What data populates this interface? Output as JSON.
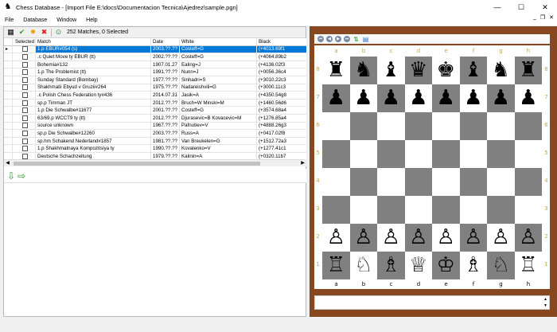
{
  "window": {
    "title": "Chess Database - [Import File E:\\docs\\Documentacion Tecnica\\Ajedrez\\sample.pgn]",
    "app_icon": "chess-knight-icon",
    "minimize": "—",
    "maximize": "☐",
    "close": "✕"
  },
  "menu": {
    "items": [
      "File",
      "Database",
      "Window",
      "Help"
    ],
    "mdi_minimize": "_",
    "mdi_restore": "❐",
    "mdi_close": "✕"
  },
  "toolbar": {
    "icons": [
      "board-icon",
      "check-icon",
      "star-icon",
      "delete-icon",
      "filter-icon"
    ],
    "status": "252 Matches, 0 Selected"
  },
  "grid": {
    "columns": [
      "",
      "Selected",
      "Match",
      "Date",
      "White",
      "Black"
    ],
    "rows": [
      {
        "match": "1.p EBUR#054 (s)",
        "date": "2003.??.??",
        "white": "Costeff=G",
        "black": "(+4013.69f1",
        "selected": true
      },
      {
        "match": ".c Quiet Move ty EBUR (tt)",
        "date": "2002.??.??",
        "white": "Costeff=G",
        "black": "(+4064.89b2",
        "selected": false
      },
      {
        "match": "Bohemia#132",
        "date": "1907.01.27",
        "white": "Ealing=J",
        "black": "(+4136.02f3",
        "selected": false
      },
      {
        "match": "1.p The Problemist (tt)",
        "date": "1991.??.??",
        "white": "Nunn=J",
        "black": "(+0056.36c4",
        "selected": false
      },
      {
        "match": "Sunday Standard (Bombay)",
        "date": "1977.??.??",
        "white": "Sinhadri=S",
        "black": "(+3010.22c3",
        "selected": false
      },
      {
        "match": "Shakhmatii Ebyud v Gruzii#264",
        "date": "1975.??.??",
        "white": "Nadareishvili=G",
        "black": "(+3000.11c3",
        "selected": false
      },
      {
        "match": ".c Polish Chess Federation ty#436",
        "date": "2014.07.31",
        "white": "Jasik=A",
        "black": "(+4350.54g8",
        "selected": false
      },
      {
        "match": "sp.p Timman JT",
        "date": "2012.??.??",
        "white": "Bruch=W Minski=M",
        "black": "(+1460.56d6",
        "selected": false
      },
      {
        "match": "1.p Die Schwalbe#11677",
        "date": "2001.??.??",
        "white": "Costeff=G",
        "black": "(+3574.68a4",
        "selected": false
      },
      {
        "match": "63/69.p WCCT9 ty (tt)",
        "date": "2012.??.??",
        "white": "Djurasevic=B Kovacevic=M",
        "black": "(+1276.85a4",
        "selected": false
      },
      {
        "match": "source unknown",
        "date": "1967.??.??",
        "white": "Pafnutiev=V",
        "black": "(+4888.26g3",
        "selected": false
      },
      {
        "match": "sp.p Die Schwalbe#12260",
        "date": "2003.??.??",
        "white": "Russ=A",
        "black": "(+0417.02f8",
        "selected": false
      },
      {
        "match": "sp.hm Schakend Nederland#1857",
        "date": "1981.??.??",
        "white": "Van Breukelen=G",
        "black": "(+1512.72a3",
        "selected": false
      },
      {
        "match": "1.p Shakhmatnaya Kompozitsiya ty",
        "date": "1990.??.??",
        "white": "Kovalenko=V",
        "black": "(+1277.41c1",
        "selected": false
      },
      {
        "match": "Deutsche Schachzeitung",
        "date": "1979.??.??",
        "white": "Kalinin=A",
        "black": "(+0320.11b7",
        "selected": false
      }
    ],
    "row_marker": "▸"
  },
  "nav": {
    "down_icon": "arrow-down-icon",
    "right_icon": "arrow-right-icon"
  },
  "board": {
    "toolbar_icons": [
      "first-move-icon",
      "prev-move-icon",
      "next-move-icon",
      "last-move-icon",
      "flip-icon",
      "edit-icon"
    ],
    "files": [
      "a",
      "b",
      "c",
      "d",
      "e",
      "f",
      "g",
      "h"
    ],
    "ranks": [
      "8",
      "7",
      "6",
      "5",
      "4",
      "3",
      "2",
      "1"
    ],
    "position": [
      [
        "♜",
        "♞",
        "♝",
        "♛",
        "♚",
        "♝",
        "♞",
        "♜"
      ],
      [
        "♟",
        "♟",
        "♟",
        "♟",
        "♟",
        "♟",
        "♟",
        "♟"
      ],
      [
        "",
        "",
        "",
        "",
        "",
        "",
        "",
        ""
      ],
      [
        "",
        "",
        "",
        "",
        "",
        "",
        "",
        ""
      ],
      [
        "",
        "",
        "",
        "",
        "",
        "",
        "",
        ""
      ],
      [
        "",
        "",
        "",
        "",
        "",
        "",
        "",
        ""
      ],
      [
        "♙",
        "♙",
        "♙",
        "♙",
        "♙",
        "♙",
        "♙",
        "♙"
      ],
      [
        "♖",
        "♘",
        "♗",
        "♕",
        "♔",
        "♗",
        "♘",
        "♖"
      ]
    ],
    "colors": {
      "dark": "#808080",
      "light": "#ffffff",
      "frame": "#87481f",
      "coord": "#c7a54d"
    }
  }
}
